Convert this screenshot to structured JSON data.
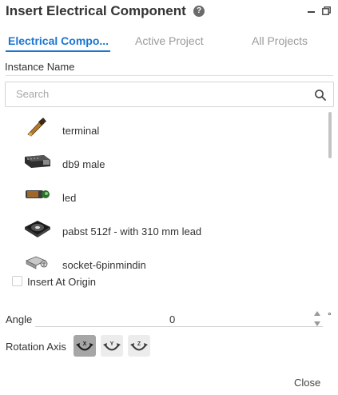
{
  "dialog": {
    "title": "Insert Electrical Component",
    "help_symbol": "?"
  },
  "tabs": [
    {
      "label": "Electrical Compo...",
      "active": true
    },
    {
      "label": "Active Project",
      "active": false
    },
    {
      "label": "All Projects",
      "active": false
    }
  ],
  "instance_name": {
    "label": "Instance Name",
    "value": ""
  },
  "search": {
    "placeholder": "Search",
    "value": ""
  },
  "components": [
    {
      "label": "terminal",
      "icon": "terminal-icon"
    },
    {
      "label": "db9 male",
      "icon": "db9-connector-icon"
    },
    {
      "label": "led",
      "icon": "led-icon"
    },
    {
      "label": "pabst 512f - with 310 mm lead",
      "icon": "fan-icon"
    },
    {
      "label": "socket-6pinmindin",
      "icon": "mini-din-socket-icon"
    }
  ],
  "insert_at_origin": {
    "label": "Insert At Origin",
    "checked": false
  },
  "angle": {
    "label": "Angle",
    "value": "0",
    "unit": "°"
  },
  "rotation_axis": {
    "label": "Rotation Axis",
    "options": [
      {
        "axis": "X",
        "selected": true
      },
      {
        "axis": "Y",
        "selected": false
      },
      {
        "axis": "Z",
        "selected": false
      }
    ]
  },
  "footer": {
    "close_label": "Close"
  },
  "colors": {
    "accent": "#1976d2",
    "selected_axis": "#a6a6a6"
  }
}
